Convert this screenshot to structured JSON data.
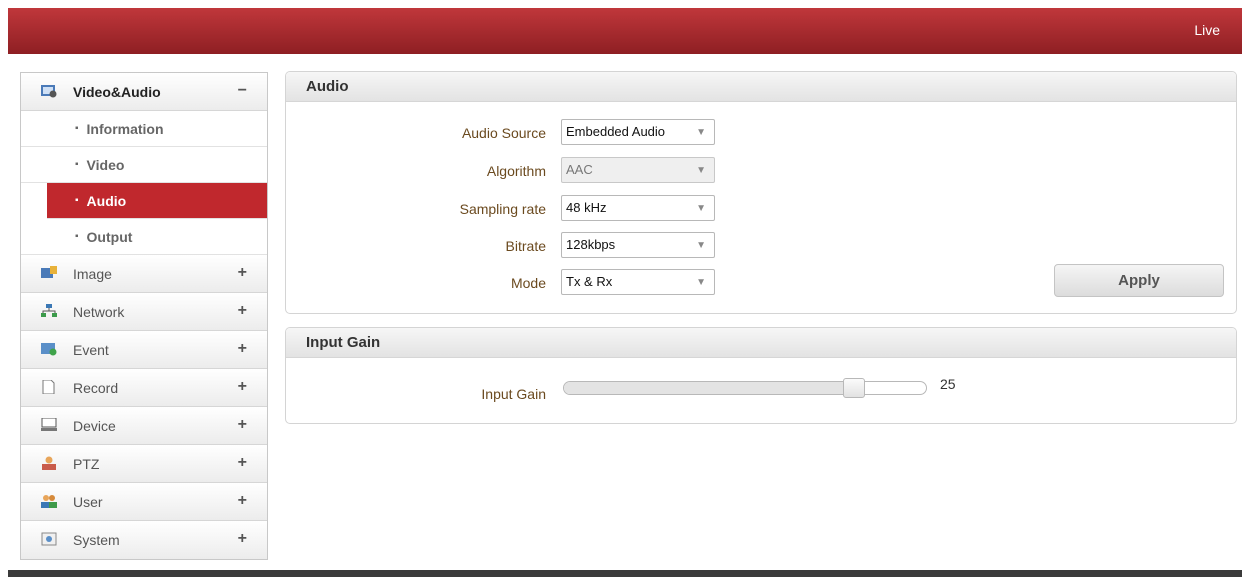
{
  "header": {
    "live_label": "Live"
  },
  "sidebar": {
    "menus": [
      {
        "label": "Video&Audio",
        "toggle": "−",
        "icon": "video-audio-icon"
      },
      {
        "label": "Image",
        "toggle": "+",
        "icon": "image-icon"
      },
      {
        "label": "Network",
        "toggle": "+",
        "icon": "network-icon"
      },
      {
        "label": "Event",
        "toggle": "+",
        "icon": "event-icon"
      },
      {
        "label": "Record",
        "toggle": "+",
        "icon": "record-icon"
      },
      {
        "label": "Device",
        "toggle": "+",
        "icon": "device-icon"
      },
      {
        "label": "PTZ",
        "toggle": "+",
        "icon": "ptz-icon"
      },
      {
        "label": "User",
        "toggle": "+",
        "icon": "user-icon"
      },
      {
        "label": "System",
        "toggle": "+",
        "icon": "system-icon"
      }
    ],
    "sub_items": [
      "Information",
      "Video",
      "Audio",
      "Output"
    ],
    "active_sub": "Audio"
  },
  "audio_panel": {
    "title": "Audio",
    "fields": [
      {
        "label": "Audio Source",
        "value": "Embedded Audio",
        "disabled": false
      },
      {
        "label": "Algorithm",
        "value": "AAC",
        "disabled": true
      },
      {
        "label": "Sampling rate",
        "value": "48 kHz",
        "disabled": false
      },
      {
        "label": "Bitrate",
        "value": "128kbps",
        "disabled": false
      },
      {
        "label": "Mode",
        "value": "Tx & Rx",
        "disabled": false
      }
    ],
    "apply_label": "Apply"
  },
  "input_gain_panel": {
    "title": "Input Gain",
    "label": "Input Gain",
    "value": "25",
    "level_fraction": 0.82
  },
  "colors": {
    "header": "#a52a2e",
    "active": "#c0282d"
  }
}
